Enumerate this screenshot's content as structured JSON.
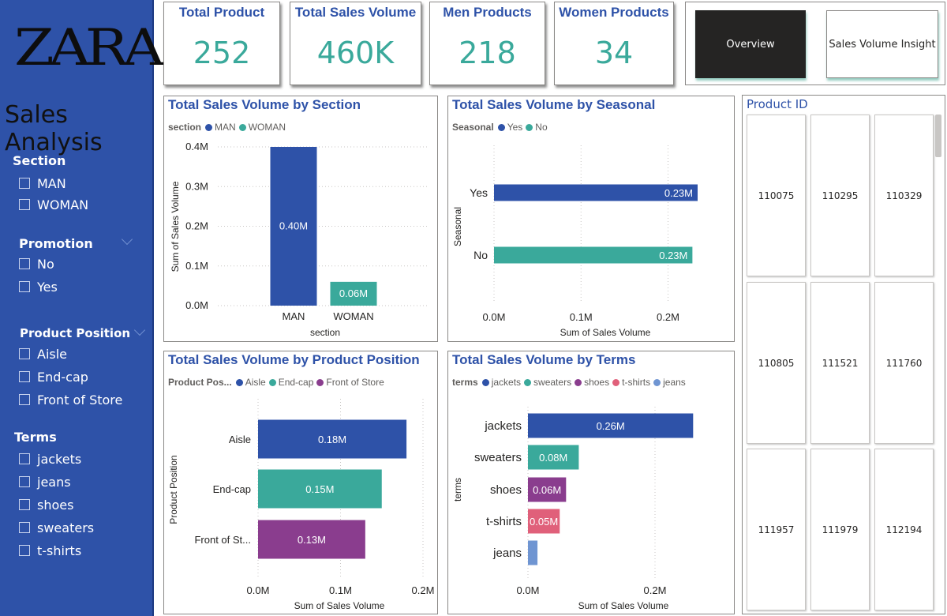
{
  "brand": {
    "logo_text": "ZARA"
  },
  "app_title": "Sales Analysis",
  "slicers": [
    {
      "title": "Section",
      "options": [
        "MAN",
        "WOMAN"
      ],
      "has_chevron": false
    },
    {
      "title": "Promotion",
      "options": [
        "No",
        "Yes"
      ],
      "has_chevron": true
    },
    {
      "title": "Product Position",
      "options": [
        "Aisle",
        "End-cap",
        "Front of Store"
      ],
      "has_chevron": true
    },
    {
      "title": "Terms",
      "options": [
        "jackets",
        "jeans",
        "shoes",
        "sweaters",
        "t-shirts"
      ],
      "has_chevron": false
    }
  ],
  "kpis": [
    {
      "label": "Total Product",
      "value": "252"
    },
    {
      "label": "Total Sales Volume",
      "value": "460K"
    },
    {
      "label": "Men Products",
      "value": "218"
    },
    {
      "label": "Women Products",
      "value": "34"
    }
  ],
  "nav": {
    "overview_label": "Overview",
    "insight_label": "Sales Volume Insight"
  },
  "colors": {
    "primary_blue": "#2e52a8",
    "teal": "#3aa99b",
    "purple": "#8a3d8e",
    "pink": "#e0607a",
    "light_blue": "#6f95d2",
    "sidebar_bg": "#2e52a8",
    "button_dark": "#252423"
  },
  "product_id": {
    "title": "Product ID",
    "ids": [
      "110075",
      "110295",
      "110329",
      "110805",
      "111521",
      "111760",
      "111957",
      "111979",
      "112194"
    ]
  },
  "chart_data": [
    {
      "type": "bar",
      "title": "Total Sales Volume by Section",
      "legend_title": "section",
      "legend_position": "top-left",
      "categories": [
        "MAN",
        "WOMAN"
      ],
      "values": [
        0.4,
        0.06
      ],
      "data_labels": [
        "0.40M",
        "0.06M"
      ],
      "colors": [
        "#2e52a8",
        "#3aa99b"
      ],
      "xlabel": "section",
      "ylabel": "Sum of Sales Volume",
      "ylim": [
        0,
        0.4
      ],
      "yticks": [
        "0.0M",
        "0.1M",
        "0.2M",
        "0.3M",
        "0.4M"
      ],
      "grid": true
    },
    {
      "type": "bar",
      "orientation": "horizontal",
      "title": "Total Sales Volume by Seasonal",
      "legend_title": "Seasonal",
      "legend_position": "top-left",
      "categories": [
        "Yes",
        "No"
      ],
      "values": [
        0.234,
        0.228
      ],
      "data_labels": [
        "0.23M",
        "0.23M"
      ],
      "colors": [
        "#2e52a8",
        "#3aa99b"
      ],
      "xlabel": "Sum of Sales Volume",
      "ylabel": "Seasonal",
      "xlim": [
        0,
        0.234
      ],
      "xticks": [
        "0.0M",
        "0.1M",
        "0.2M"
      ],
      "grid": true
    },
    {
      "type": "bar",
      "orientation": "horizontal",
      "title": "Total Sales Volume by Product Position",
      "legend_title": "Product Pos...",
      "legend_entries": [
        "Aisle",
        "End-cap",
        "Front of Store"
      ],
      "legend_position": "top-left",
      "categories": [
        "Aisle",
        "End-cap",
        "Front of St..."
      ],
      "values": [
        0.18,
        0.15,
        0.13
      ],
      "data_labels": [
        "0.18M",
        "0.15M",
        "0.13M"
      ],
      "colors": [
        "#2e52a8",
        "#3aa99b",
        "#8a3d8e"
      ],
      "xlabel": "Sum of Sales Volume",
      "ylabel": "Product Position",
      "xlim": [
        0,
        0.2
      ],
      "xticks": [
        "0.0M",
        "0.1M",
        "0.2M"
      ],
      "grid": true
    },
    {
      "type": "bar",
      "orientation": "horizontal",
      "title": "Total Sales Volume by Terms",
      "legend_title": "terms",
      "legend_position": "top-left",
      "categories": [
        "jackets",
        "sweaters",
        "shoes",
        "t-shirts",
        "jeans"
      ],
      "values": [
        0.26,
        0.08,
        0.06,
        0.05,
        0.015
      ],
      "data_labels": [
        "0.26M",
        "0.08M",
        "0.06M",
        "0.05M",
        ""
      ],
      "colors": [
        "#2e52a8",
        "#3aa99b",
        "#8a3d8e",
        "#e0607a",
        "#6f95d2"
      ],
      "xlabel": "Sum of Sales Volume",
      "ylabel": "terms",
      "xlim": [
        0,
        0.2
      ],
      "xticks": [
        "0.0M",
        "0.2M"
      ],
      "grid": true
    }
  ]
}
